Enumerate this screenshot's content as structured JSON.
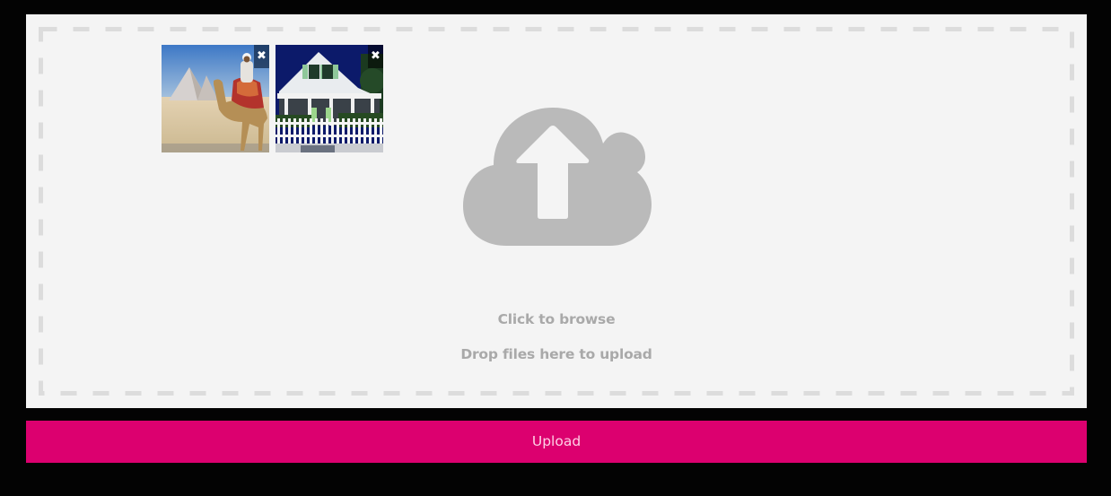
{
  "dropzone": {
    "browse_label": "Click to browse",
    "drop_label": "Drop files here to upload",
    "icon": "cloud-upload-icon",
    "files": [
      {
        "thumbnail": "camel-pyramids-photo",
        "remove_label": "✖",
        "remove_icon": "close-icon"
      },
      {
        "thumbnail": "white-house-photo",
        "remove_label": "✖",
        "remove_icon": "close-icon"
      }
    ]
  },
  "upload_button": {
    "label": "Upload"
  },
  "colors": {
    "accent": "#dc006f",
    "dropzone_bg": "#f4f4f4",
    "dash_border": "#dcdcdc",
    "hint_text": "#a9a9a9",
    "icon": "#bababa",
    "overlay": "#030303"
  }
}
